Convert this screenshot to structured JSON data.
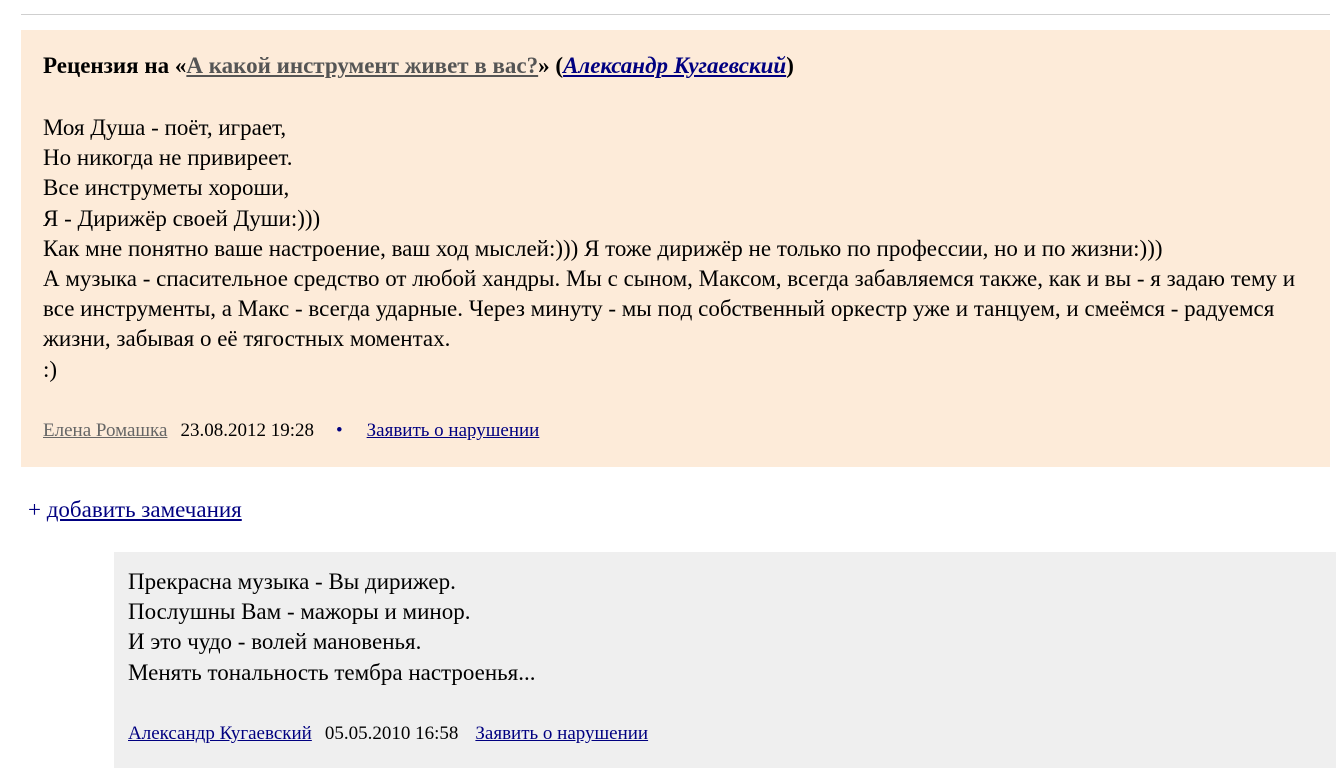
{
  "review": {
    "title_prefix": "Рецензия на «",
    "work_title": "А какой инструмент живет в вас?",
    "title_mid": "» (",
    "work_author": "Александр Кугаевский",
    "title_suffix": ")",
    "lines": [
      "Моя Душа - поёт, играет,",
      "Но никогда не привиреет.",
      "Все инструметы хороши,",
      "Я - Дирижёр своей Души:)))",
      "Как мне понятно ваше настроение, ваш ход мыслей:))) Я тоже дирижёр не только по профессии, но и по жизни:)))"
    ],
    "paragraph": "А музыка - спасительное средство от любой хандры. Мы с сыном, Максом, всегда забавляемся также, как и вы - я задаю тему и все инструменты, а Макс - всегда ударные. Через минуту - мы под собственный оркестр уже и танцуем, и смеёмся - радуемся жизни, забывая о её тягостных моментах.",
    "smile": ":)",
    "author": "Елена Ромашка",
    "date": "23.08.2012 19:28",
    "separator": "•",
    "report_label": "Заявить о нарушении"
  },
  "add_remarks": {
    "plus": "+ ",
    "label": "добавить замечания"
  },
  "reply": {
    "lines": [
      "Прекрасна музыка - Вы дирижер.",
      "Послушны Вам - мажоры и минор.",
      "И это чудо - волей мановенья.",
      "Менять тональность тембра настроенья..."
    ],
    "author": "Александр Кугаевский",
    "date": "05.05.2010 16:58",
    "report_label": "Заявить о нарушении"
  }
}
